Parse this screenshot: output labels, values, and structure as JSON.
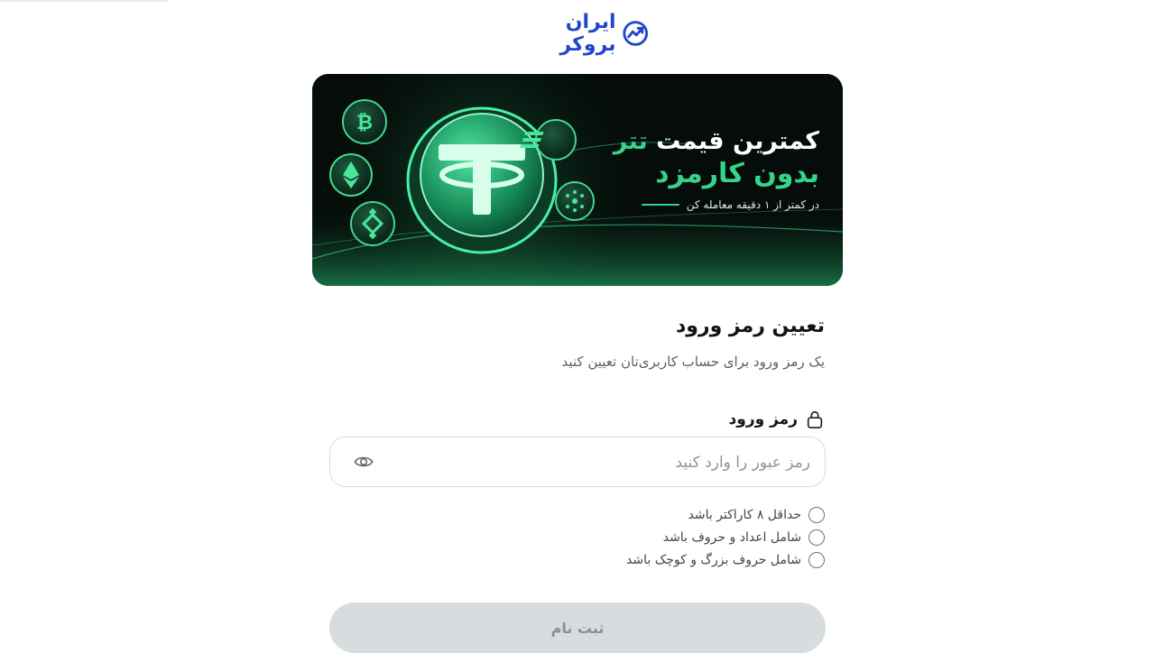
{
  "brand": {
    "name": "ایران بروکر",
    "color": "#1f48c9"
  },
  "banner": {
    "line1_pre": "کمترین قیمت",
    "line1_accent": "تتر",
    "line2": "بدون کارمزد",
    "line3": "در کمتر از ۱ دقیقه معامله کن",
    "accent_color": "#35d488",
    "icons": [
      "bitcoin-coin-icon",
      "ethereum-coin-icon",
      "binance-coin-icon",
      "tether-coin-icon",
      "solana-coin-icon",
      "cardano-coin-icon"
    ]
  },
  "form": {
    "title": "تعیین رمز ورود",
    "subtitle": "یک رمز ورود برای حساب کاربری‌تان تعیین کنید",
    "password_label": "رمز ورود",
    "password_placeholder": "رمز عبور را وارد کنید",
    "password_value": "",
    "rules": [
      "حداقل ۸ کاراکتر باشد",
      "شامل اعداد و حروف باشد",
      "شامل حروف بزرگ و کوچک باشد"
    ],
    "submit_label": "ثبت نام"
  }
}
